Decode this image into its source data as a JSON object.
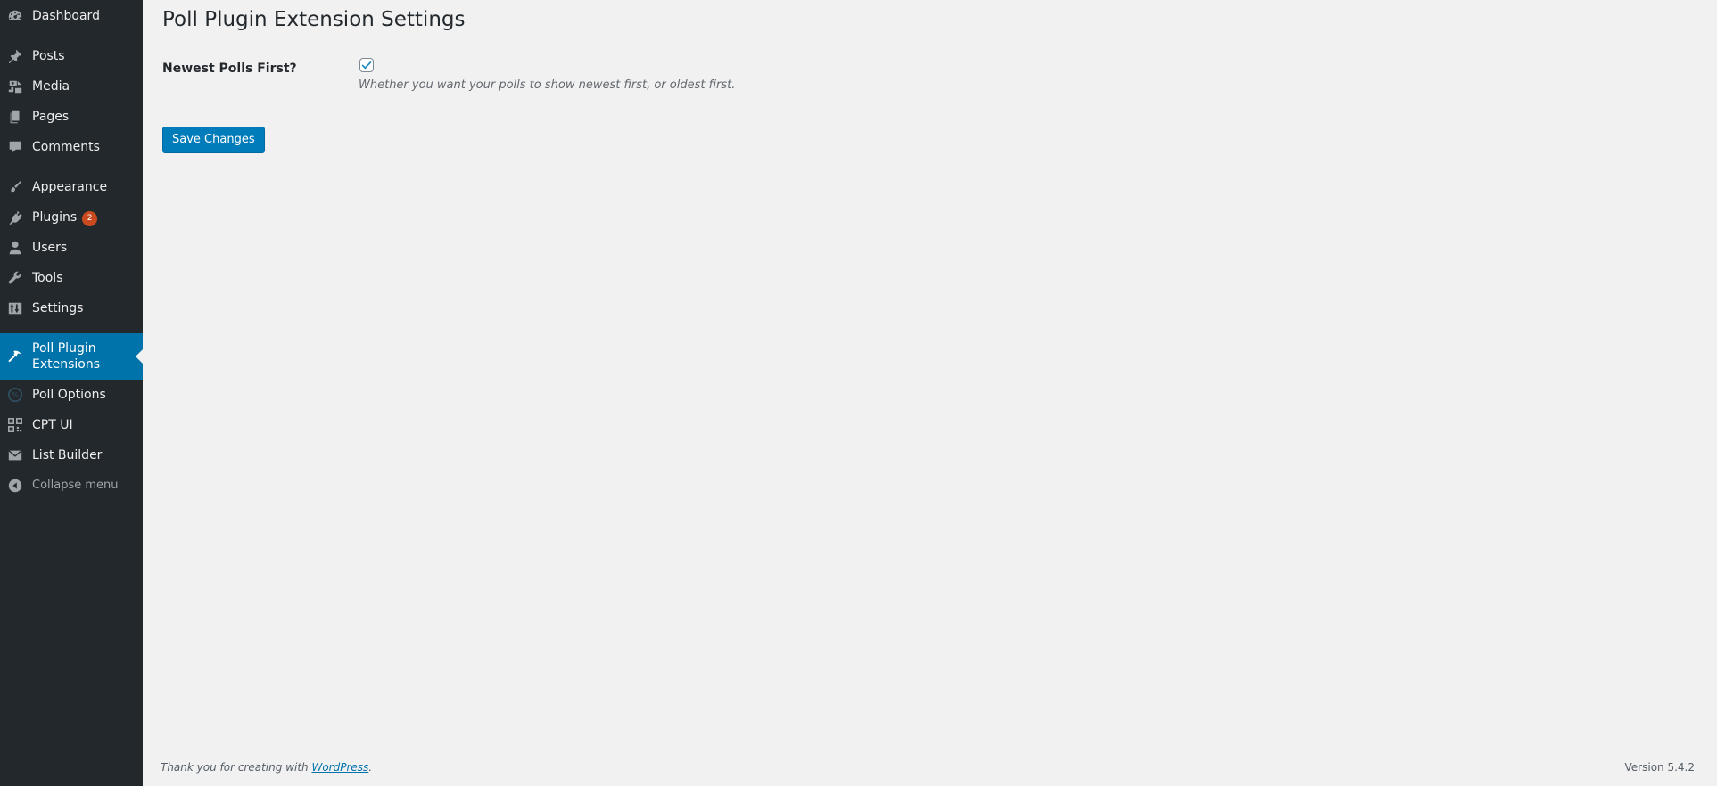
{
  "sidebar": {
    "items": [
      {
        "label": "Dashboard",
        "icon": "dashboard-icon"
      },
      {
        "label": "Posts",
        "icon": "pushpin-icon"
      },
      {
        "label": "Media",
        "icon": "media-icon"
      },
      {
        "label": "Pages",
        "icon": "pages-icon"
      },
      {
        "label": "Comments",
        "icon": "comment-icon"
      },
      {
        "label": "Appearance",
        "icon": "paintbrush-icon"
      },
      {
        "label": "Plugins",
        "icon": "plug-icon",
        "badge": "2"
      },
      {
        "label": "Users",
        "icon": "user-icon"
      },
      {
        "label": "Tools",
        "icon": "wrench-icon"
      },
      {
        "label": "Settings",
        "icon": "settings-icon"
      },
      {
        "label": "Poll Plugin Extensions",
        "icon": "hammer-icon",
        "current": true
      },
      {
        "label": "Poll Options",
        "icon": "poll-icon"
      },
      {
        "label": "CPT UI",
        "icon": "grid-icon"
      },
      {
        "label": "List Builder",
        "icon": "envelope-icon"
      }
    ],
    "collapse_label": "Collapse menu"
  },
  "main": {
    "title": "Poll Plugin Extension Settings",
    "field_label": "Newest Polls First?",
    "checkbox_checked": true,
    "description": "Whether you want your polls to show newest first, or oldest first.",
    "save_label": "Save Changes"
  },
  "footer": {
    "thanks_prefix": "Thank you for creating with ",
    "thanks_link": "WordPress",
    "thanks_suffix": ".",
    "version": "Version 5.4.2"
  },
  "colors": {
    "sidebar_bg": "#23282d",
    "accent": "#0073aa",
    "badge": "#ca4a1f",
    "page_bg": "#f1f1f1"
  }
}
